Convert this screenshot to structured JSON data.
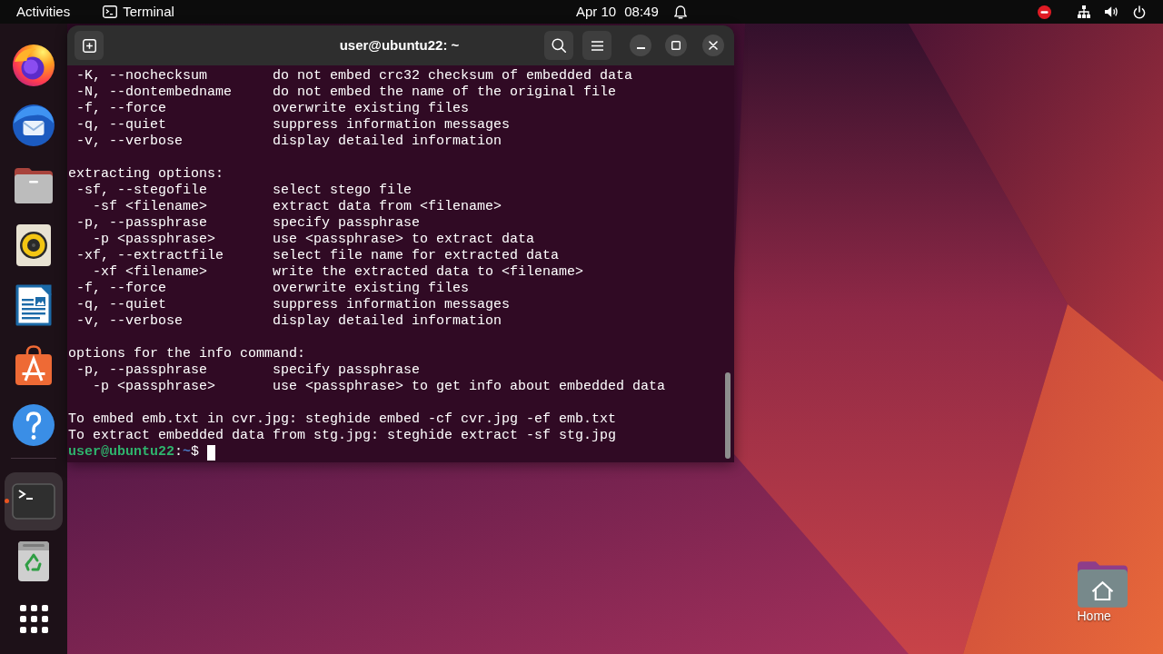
{
  "top_bar": {
    "activities": "Activities",
    "app_menu": "Terminal",
    "clock": {
      "date": "Apr 10",
      "time": "08:49"
    }
  },
  "dock": {
    "favorites": [
      {
        "kind": "browser",
        "running": false,
        "focused": false
      },
      {
        "kind": "mail",
        "running": false,
        "focused": false
      },
      {
        "kind": "files",
        "running": false,
        "focused": false
      },
      {
        "kind": "music",
        "running": false,
        "focused": false
      },
      {
        "kind": "writer",
        "running": false,
        "focused": false
      },
      {
        "kind": "store",
        "running": false,
        "focused": false
      },
      {
        "kind": "help",
        "running": false,
        "focused": false
      }
    ],
    "others": [
      {
        "kind": "terminal",
        "running": true,
        "focused": true
      },
      {
        "kind": "trash",
        "running": false,
        "focused": false
      }
    ]
  },
  "window": {
    "title": "user@ubuntu22: ~"
  },
  "terminal": {
    "sections": [
      {
        "options": [
          {
            "flag": "-K, --nochecksum",
            "description": "do not embed crc32 checksum of embedded data"
          },
          {
            "flag": "-N, --dontembedname",
            "description": "do not embed the name of the original file"
          },
          {
            "flag": "-f, --force",
            "description": "overwrite existing files"
          },
          {
            "flag": "-q, --quiet",
            "description": "suppress information messages"
          },
          {
            "flag": "-v, --verbose",
            "description": "display detailed information"
          }
        ]
      },
      {
        "heading": "extracting options:",
        "options": [
          {
            "flag": "-sf, --stegofile",
            "description": "select stego file",
            "children": [
              {
                "flag": "-sf <filename>",
                "description": "extract data from <filename>"
              }
            ]
          },
          {
            "flag": "-p, --passphrase",
            "description": "specify passphrase",
            "children": [
              {
                "flag": "-p <passphrase>",
                "description": "use <passphrase> to extract data"
              }
            ]
          },
          {
            "flag": "-xf, --extractfile",
            "description": "select file name for extracted data",
            "children": [
              {
                "flag": "-xf <filename>",
                "description": "write the extracted data to <filename>"
              }
            ]
          },
          {
            "flag": "-f, --force",
            "description": "overwrite existing files"
          },
          {
            "flag": "-q, --quiet",
            "description": "suppress information messages"
          },
          {
            "flag": "-v, --verbose",
            "description": "display detailed information"
          }
        ]
      },
      {
        "heading": "options for the info command:",
        "options": [
          {
            "flag": "-p, --passphrase",
            "description": "specify passphrase",
            "children": [
              {
                "flag": "-p <passphrase>",
                "description": "use <passphrase> to get info about embedded data"
              }
            ]
          }
        ]
      }
    ],
    "examples": [
      "To embed emb.txt in cvr.jpg: steghide embed -cf cvr.jpg -ef emb.txt",
      "To extract embedded data from stg.jpg: steghide extract -sf stg.jpg"
    ],
    "prompt": {
      "user_host": "user@ubuntu22",
      "separator": ":",
      "path": "~",
      "symbol": "$"
    }
  },
  "desktop": {
    "icons": [
      {
        "label": "Home"
      }
    ]
  }
}
